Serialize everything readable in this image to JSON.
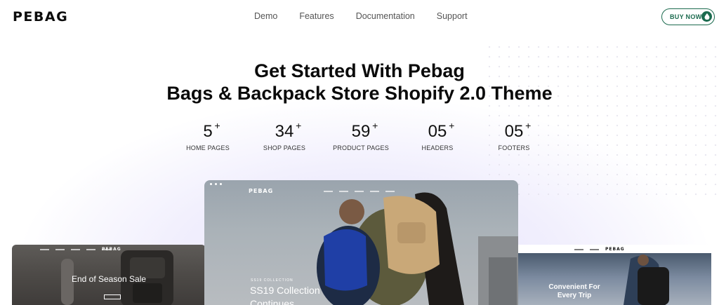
{
  "header": {
    "logo": "PEBAG",
    "nav": [
      "Demo",
      "Features",
      "Documentation",
      "Support"
    ],
    "buy_label": "BUY NOW",
    "buy_icon": "drop-icon",
    "accent_color": "#1c6b4f"
  },
  "hero": {
    "title_line1": "Get Started With Pebag",
    "title_line2": "Bags & Backpack Store Shopify 2.0 Theme"
  },
  "stats": [
    {
      "value": "5",
      "plus": "+",
      "label": "HOME PAGES"
    },
    {
      "value": "34",
      "plus": "+",
      "label": "SHOP PAGES"
    },
    {
      "value": "59",
      "plus": "+",
      "label": "PRODUCT PAGES"
    },
    {
      "value": "05",
      "plus": "+",
      "label": "HEADERS"
    },
    {
      "value": "05",
      "plus": "+",
      "label": "FOOTERS"
    }
  ],
  "previews": {
    "left": {
      "logo": "PEBAG",
      "headline": "End of Season Sale"
    },
    "center": {
      "logo": "PEBAG",
      "kicker": "SS19 COLLECTION",
      "headline_line1": "SS19 Collection",
      "headline_line2": "Continues"
    },
    "right": {
      "logo": "PEBAG",
      "headline_line1": "Convenient For",
      "headline_line2": "Every Trip"
    }
  }
}
